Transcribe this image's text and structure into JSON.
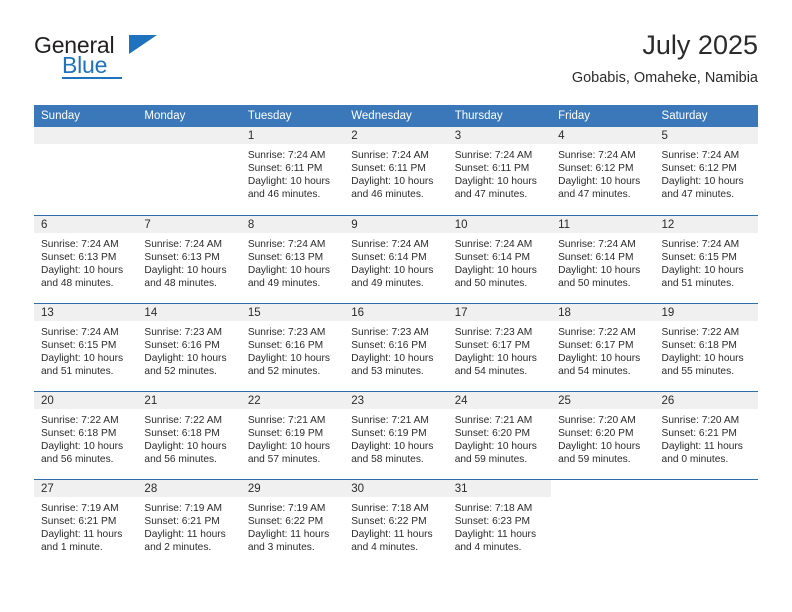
{
  "brand": {
    "name_part1": "General",
    "name_part2": "Blue",
    "triangle_color": "#1f72bd",
    "text_color": "#231f20"
  },
  "header": {
    "title": "July 2025",
    "subtitle": "Gobabis, Omaheke, Namibia"
  },
  "theme": {
    "header_bg": "#3a78ba",
    "row_divider": "#2f6cab",
    "daynum_band_bg": "#f0f0f0",
    "text": "#2b2b2b"
  },
  "calendar": {
    "weekday_headers": [
      "Sunday",
      "Monday",
      "Tuesday",
      "Wednesday",
      "Thursday",
      "Friday",
      "Saturday"
    ],
    "labels": {
      "sunrise": "Sunrise:",
      "sunset": "Sunset:",
      "daylight": "Daylight:"
    },
    "weeks": [
      [
        {
          "day": "",
          "blank": true
        },
        {
          "day": "",
          "blank": true
        },
        {
          "day": "1",
          "sunrise": "Sunrise: 7:24 AM",
          "sunset": "Sunset: 6:11 PM",
          "daylight": "Daylight: 10 hours and 46 minutes."
        },
        {
          "day": "2",
          "sunrise": "Sunrise: 7:24 AM",
          "sunset": "Sunset: 6:11 PM",
          "daylight": "Daylight: 10 hours and 46 minutes."
        },
        {
          "day": "3",
          "sunrise": "Sunrise: 7:24 AM",
          "sunset": "Sunset: 6:11 PM",
          "daylight": "Daylight: 10 hours and 47 minutes."
        },
        {
          "day": "4",
          "sunrise": "Sunrise: 7:24 AM",
          "sunset": "Sunset: 6:12 PM",
          "daylight": "Daylight: 10 hours and 47 minutes."
        },
        {
          "day": "5",
          "sunrise": "Sunrise: 7:24 AM",
          "sunset": "Sunset: 6:12 PM",
          "daylight": "Daylight: 10 hours and 47 minutes."
        }
      ],
      [
        {
          "day": "6",
          "sunrise": "Sunrise: 7:24 AM",
          "sunset": "Sunset: 6:13 PM",
          "daylight": "Daylight: 10 hours and 48 minutes."
        },
        {
          "day": "7",
          "sunrise": "Sunrise: 7:24 AM",
          "sunset": "Sunset: 6:13 PM",
          "daylight": "Daylight: 10 hours and 48 minutes."
        },
        {
          "day": "8",
          "sunrise": "Sunrise: 7:24 AM",
          "sunset": "Sunset: 6:13 PM",
          "daylight": "Daylight: 10 hours and 49 minutes."
        },
        {
          "day": "9",
          "sunrise": "Sunrise: 7:24 AM",
          "sunset": "Sunset: 6:14 PM",
          "daylight": "Daylight: 10 hours and 49 minutes."
        },
        {
          "day": "10",
          "sunrise": "Sunrise: 7:24 AM",
          "sunset": "Sunset: 6:14 PM",
          "daylight": "Daylight: 10 hours and 50 minutes."
        },
        {
          "day": "11",
          "sunrise": "Sunrise: 7:24 AM",
          "sunset": "Sunset: 6:14 PM",
          "daylight": "Daylight: 10 hours and 50 minutes."
        },
        {
          "day": "12",
          "sunrise": "Sunrise: 7:24 AM",
          "sunset": "Sunset: 6:15 PM",
          "daylight": "Daylight: 10 hours and 51 minutes."
        }
      ],
      [
        {
          "day": "13",
          "sunrise": "Sunrise: 7:24 AM",
          "sunset": "Sunset: 6:15 PM",
          "daylight": "Daylight: 10 hours and 51 minutes."
        },
        {
          "day": "14",
          "sunrise": "Sunrise: 7:23 AM",
          "sunset": "Sunset: 6:16 PM",
          "daylight": "Daylight: 10 hours and 52 minutes."
        },
        {
          "day": "15",
          "sunrise": "Sunrise: 7:23 AM",
          "sunset": "Sunset: 6:16 PM",
          "daylight": "Daylight: 10 hours and 52 minutes."
        },
        {
          "day": "16",
          "sunrise": "Sunrise: 7:23 AM",
          "sunset": "Sunset: 6:16 PM",
          "daylight": "Daylight: 10 hours and 53 minutes."
        },
        {
          "day": "17",
          "sunrise": "Sunrise: 7:23 AM",
          "sunset": "Sunset: 6:17 PM",
          "daylight": "Daylight: 10 hours and 54 minutes."
        },
        {
          "day": "18",
          "sunrise": "Sunrise: 7:22 AM",
          "sunset": "Sunset: 6:17 PM",
          "daylight": "Daylight: 10 hours and 54 minutes."
        },
        {
          "day": "19",
          "sunrise": "Sunrise: 7:22 AM",
          "sunset": "Sunset: 6:18 PM",
          "daylight": "Daylight: 10 hours and 55 minutes."
        }
      ],
      [
        {
          "day": "20",
          "sunrise": "Sunrise: 7:22 AM",
          "sunset": "Sunset: 6:18 PM",
          "daylight": "Daylight: 10 hours and 56 minutes."
        },
        {
          "day": "21",
          "sunrise": "Sunrise: 7:22 AM",
          "sunset": "Sunset: 6:18 PM",
          "daylight": "Daylight: 10 hours and 56 minutes."
        },
        {
          "day": "22",
          "sunrise": "Sunrise: 7:21 AM",
          "sunset": "Sunset: 6:19 PM",
          "daylight": "Daylight: 10 hours and 57 minutes."
        },
        {
          "day": "23",
          "sunrise": "Sunrise: 7:21 AM",
          "sunset": "Sunset: 6:19 PM",
          "daylight": "Daylight: 10 hours and 58 minutes."
        },
        {
          "day": "24",
          "sunrise": "Sunrise: 7:21 AM",
          "sunset": "Sunset: 6:20 PM",
          "daylight": "Daylight: 10 hours and 59 minutes."
        },
        {
          "day": "25",
          "sunrise": "Sunrise: 7:20 AM",
          "sunset": "Sunset: 6:20 PM",
          "daylight": "Daylight: 10 hours and 59 minutes."
        },
        {
          "day": "26",
          "sunrise": "Sunrise: 7:20 AM",
          "sunset": "Sunset: 6:21 PM",
          "daylight": "Daylight: 11 hours and 0 minutes."
        }
      ],
      [
        {
          "day": "27",
          "sunrise": "Sunrise: 7:19 AM",
          "sunset": "Sunset: 6:21 PM",
          "daylight": "Daylight: 11 hours and 1 minute."
        },
        {
          "day": "28",
          "sunrise": "Sunrise: 7:19 AM",
          "sunset": "Sunset: 6:21 PM",
          "daylight": "Daylight: 11 hours and 2 minutes."
        },
        {
          "day": "29",
          "sunrise": "Sunrise: 7:19 AM",
          "sunset": "Sunset: 6:22 PM",
          "daylight": "Daylight: 11 hours and 3 minutes."
        },
        {
          "day": "30",
          "sunrise": "Sunrise: 7:18 AM",
          "sunset": "Sunset: 6:22 PM",
          "daylight": "Daylight: 11 hours and 4 minutes."
        },
        {
          "day": "31",
          "sunrise": "Sunrise: 7:18 AM",
          "sunset": "Sunset: 6:23 PM",
          "daylight": "Daylight: 11 hours and 4 minutes."
        },
        {
          "day": "",
          "nocell": true
        },
        {
          "day": "",
          "nocell": true
        }
      ]
    ]
  }
}
